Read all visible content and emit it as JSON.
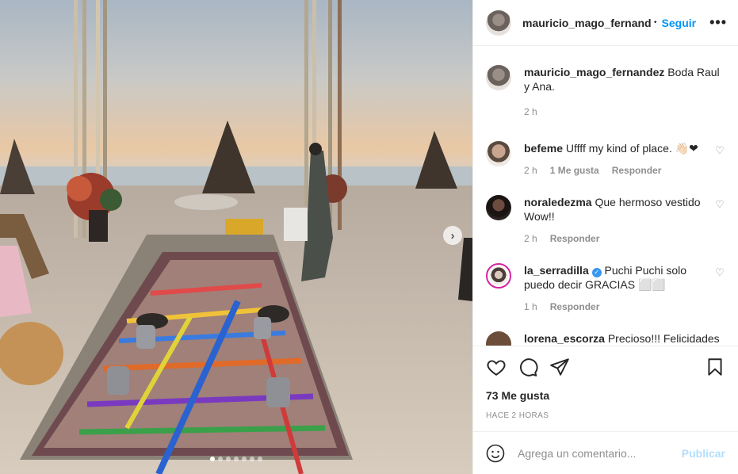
{
  "post": {
    "username": "mauricio_mago_fernandez",
    "follow_label": "Seguir",
    "more_label": "•••",
    "photo_alt": "Boda Raul y Ana",
    "carousel": {
      "count": 7,
      "active": 0
    }
  },
  "caption": {
    "username": "mauricio_mago_fernandez",
    "text": "Boda Raul y Ana.",
    "time": "2 h"
  },
  "comments": [
    {
      "username": "befeme",
      "text": "Uffff my kind of place. 👋🏻❤",
      "time": "2 h",
      "likes": "1 Me gusta",
      "reply": "Responder"
    },
    {
      "username": "noraledezma",
      "text": "Que hermoso vestido Wow!!",
      "time": "2 h",
      "likes": "",
      "reply": "Responder"
    },
    {
      "username": "la_serradilla",
      "verified": true,
      "text": "Puchi Puchi solo puedo decir GRACIAS ⬜⬜",
      "time": "1 h",
      "likes": "",
      "reply": "Responder"
    },
    {
      "username": "lorena_escorza",
      "text": "Precioso!!! Felicidades",
      "time": "",
      "likes": "",
      "reply": ""
    }
  ],
  "actions": {
    "likes": "73 Me gusta",
    "posted_ago": "HACE 2 HORAS"
  },
  "add_comment": {
    "placeholder": "Agrega un comentario...",
    "publish": "Publicar"
  },
  "colors": {
    "link_blue": "#0095f6",
    "muted": "#8e8e8e",
    "publish_disabled": "#b2dffc"
  }
}
